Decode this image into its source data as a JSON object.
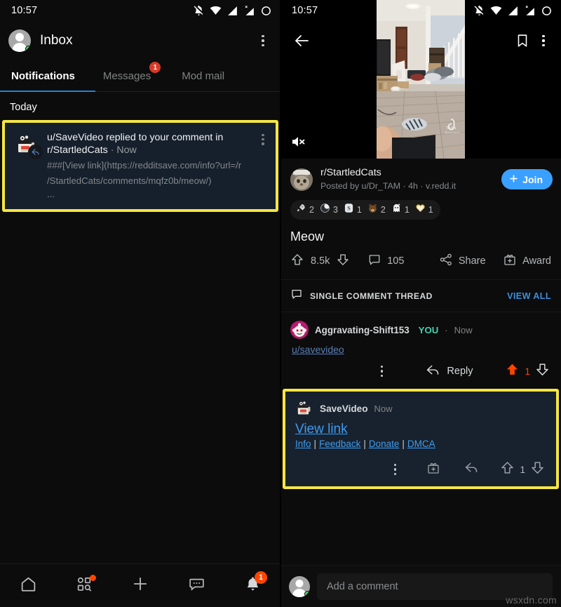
{
  "status_bar": {
    "time": "10:57",
    "icons": [
      "bell-off-icon",
      "wifi-icon",
      "signal-icon",
      "signal-no-sim-icon",
      "battery-circle-icon"
    ]
  },
  "left_panel": {
    "header": {
      "title": "Inbox",
      "overflow_icon": "kebab-menu-icon",
      "avatar_icon": "user-avatar"
    },
    "tabs": [
      {
        "label": "Notifications",
        "active": true,
        "badge": ""
      },
      {
        "label": "Messages",
        "active": false,
        "badge": "1"
      },
      {
        "label": "Mod mail",
        "active": false,
        "badge": ""
      }
    ],
    "section_label": "Today",
    "notification": {
      "avatar_icon": "savevideo-bot-avatar",
      "overlay_icon": "reply-arrow-icon",
      "title_actor": "u/SaveVideo",
      "title_rest": " replied to your comment in",
      "title_line2": "r/StartledCats",
      "time": "Now",
      "separator": "·",
      "preview_line1": "###[View link](https://redditsave.com/info?url=/r",
      "preview_line2": "/StartledCats/comments/mqfz0b/meow/)",
      "preview_line3": "...",
      "overflow_icon": "kebab-menu-icon",
      "highlight_color": "#f5e642"
    },
    "bottom_nav": [
      {
        "name": "home",
        "icon": "home-icon",
        "badge": "",
        "dot": false
      },
      {
        "name": "discover",
        "icon": "discover-icon",
        "badge": "",
        "dot": true
      },
      {
        "name": "create",
        "icon": "plus-icon",
        "badge": "",
        "dot": false
      },
      {
        "name": "chat",
        "icon": "chat-bubble-icon",
        "badge": "",
        "dot": false
      },
      {
        "name": "inbox",
        "icon": "bell-filled-icon",
        "badge": "1",
        "dot": false
      }
    ]
  },
  "right_panel": {
    "topbar": {
      "back_icon": "back-arrow-icon",
      "save_icon": "bookmark-icon",
      "overflow_icon": "kebab-menu-icon",
      "mute_icon": "volume-muted-icon"
    },
    "post": {
      "subreddit": "r/StartledCats",
      "byline": "Posted by u/Dr_TAM · 4h · v.redd.it",
      "join_label": "Join",
      "join_icon": "plus-icon",
      "join_color": "#3aa0ff",
      "title": "Meow",
      "awards": [
        {
          "icon": "silver-rocket-award",
          "count": "2"
        },
        {
          "icon": "wholesome-swirl-award",
          "count": "3"
        },
        {
          "icon": "silver-s-award",
          "count": "1"
        },
        {
          "icon": "bear-award",
          "count": "2"
        },
        {
          "icon": "cat-ghost-award",
          "count": "1"
        },
        {
          "icon": "gold-heart-award",
          "count": "1"
        }
      ],
      "actions": {
        "upvote_icon": "upvote-arrow-icon",
        "downvote_icon": "downvote-arrow-icon",
        "score": "8.5k",
        "comment_icon": "comment-bubble-icon",
        "comment_count": "105",
        "share_icon": "share-icon",
        "share_label": "Share",
        "award_icon": "award-gift-icon",
        "award_label": "Award"
      }
    },
    "thread_bar": {
      "icon": "comment-bubble-icon",
      "label": "SINGLE COMMENT THREAD",
      "view_all": "VIEW ALL",
      "view_all_color": "#3a8fe0"
    },
    "user_comment": {
      "avatar_icon": "reddit-snoo-avatar",
      "author": "Aggravating-Shift153",
      "you_tag": "YOU",
      "separator": "·",
      "time": "Now",
      "body_link": "u/savevideo",
      "overflow_icon": "kebab-menu-icon",
      "reply_icon": "reply-arrow-icon",
      "reply_label": "Reply",
      "upvote_icon": "upvote-arrow-filled-icon",
      "vote_count": "1",
      "downvote_icon": "downvote-arrow-icon",
      "vote_color": "#ff4500"
    },
    "bot_comment": {
      "highlight_color": "#f5e642",
      "avatar_icon": "savevideo-bot-avatar",
      "author": "SaveVideo",
      "time": "Now",
      "view_link_label": "View link",
      "links": [
        {
          "label": "Info"
        },
        {
          "label": "Feedback"
        },
        {
          "label": "Donate"
        },
        {
          "label": "DMCA"
        }
      ],
      "link_separator": "|",
      "overflow_icon": "kebab-menu-icon",
      "award_icon": "award-gift-icon",
      "reply_icon": "reply-arrow-icon",
      "upvote_icon": "upvote-arrow-icon",
      "vote_count": "1",
      "downvote_icon": "downvote-arrow-icon"
    },
    "composer": {
      "avatar_icon": "user-avatar",
      "placeholder": "Add a comment"
    }
  },
  "watermark": "wsxdn.com"
}
